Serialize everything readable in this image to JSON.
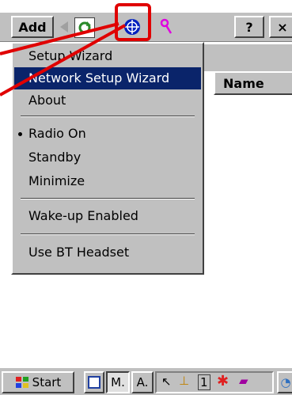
{
  "toolbar": {
    "add_label": "Add",
    "help_label": "?",
    "close_label": "×"
  },
  "list": {
    "name_header": "Name"
  },
  "menu": {
    "items": [
      {
        "label": "Setup Wizard"
      },
      {
        "label": "Network Setup Wizard",
        "selected": true
      },
      {
        "label": "About"
      },
      {
        "label": "Radio On",
        "checked": true
      },
      {
        "label": "Standby"
      },
      {
        "label": "Minimize"
      },
      {
        "label": "Wake-up Enabled"
      },
      {
        "label": "Use BT Headset"
      }
    ]
  },
  "taskbar": {
    "start_label": "Start",
    "task1_label": "M.",
    "task2_label": "A.",
    "tray_number": "1"
  },
  "colors": {
    "highlight": "#0a246a",
    "annotation": "#e00000"
  }
}
